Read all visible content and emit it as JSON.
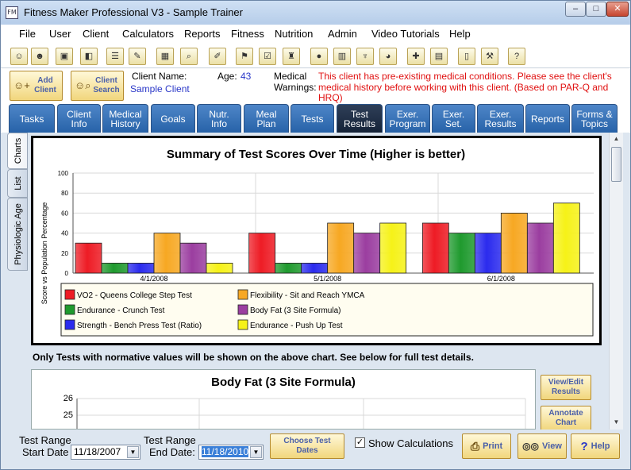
{
  "window": {
    "title": "Fitness Maker Professional V3 - Sample Trainer",
    "app_icon": "FM",
    "controls": [
      "–",
      "□",
      "✕"
    ]
  },
  "menu": [
    "File",
    "User",
    "Client",
    "Calculators",
    "Reports",
    "Fitness",
    "Nutrition",
    "Admin",
    "Video Tutorials",
    "Help"
  ],
  "toolbar_icons": [
    "users-icon",
    "user-icon",
    "save-icon",
    "exit-icon",
    "list-icon",
    "edit-icon",
    "assess-icon",
    "search-icon",
    "note-icon",
    "flag-icon",
    "check-icon",
    "weights-icon",
    "apple-icon",
    "chart-icon",
    "cutlery-icon",
    "food-icon",
    "add-icon",
    "export-icon",
    "clipboard-icon",
    "tools-icon",
    "help-icon"
  ],
  "toolbar_glyphs": [
    "☺",
    "☻",
    "▣",
    "◧",
    "☰",
    "✎",
    "▦",
    "⌕",
    "✐",
    "⚑",
    "☑",
    "♜",
    "●",
    "▥",
    "♆",
    "◕",
    "✚",
    "▤",
    "▯",
    "⚒",
    "?"
  ],
  "client_bar": {
    "add_client": "Add Client",
    "client_search": "Client Search",
    "client_name_label": "Client Name:",
    "client_name": "Sample Client",
    "age_label": "Age:",
    "age": "43",
    "warnings_label_1": "Medical",
    "warnings_label_2": "Warnings:",
    "warning_line_1": "This client has pre-existing medical conditions. Please see the client's",
    "warning_line_2": "medical history before working with this client.  (Based on PAR-Q and",
    "warning_line_3": "HRQ)"
  },
  "tabs": [
    {
      "l1": "Tasks",
      "l2": ""
    },
    {
      "l1": "Client",
      "l2": "Info"
    },
    {
      "l1": "Medical",
      "l2": "History"
    },
    {
      "l1": "Goals",
      "l2": ""
    },
    {
      "l1": "Nutr.",
      "l2": "Info"
    },
    {
      "l1": "Meal",
      "l2": "Plan"
    },
    {
      "l1": "Tests",
      "l2": ""
    },
    {
      "l1": "Test",
      "l2": "Results"
    },
    {
      "l1": "Exer.",
      "l2": "Program"
    },
    {
      "l1": "Exer.",
      "l2": "Set."
    },
    {
      "l1": "Exer.",
      "l2": "Results"
    },
    {
      "l1": "Reports",
      "l2": ""
    },
    {
      "l1": "Forms &",
      "l2": "Topics"
    }
  ],
  "active_tab": 7,
  "side_tabs": [
    "Charts",
    "List",
    "Physiologic Age"
  ],
  "chart_data": [
    {
      "type": "bar",
      "title": "Summary of Test Scores Over Time (Higher is better)",
      "ylabel": "Score vs Population Percentage",
      "xlabel": "",
      "ylim": [
        0,
        100
      ],
      "yticks": [
        "0",
        "20",
        "40",
        "60",
        "80",
        "100"
      ],
      "categories": [
        "4/1/2008",
        "5/1/2008",
        "6/1/2008"
      ],
      "grid": true,
      "legend": "bottom",
      "series": [
        {
          "name": "VO2 - Queens College Step Test",
          "color": "#ee1c25",
          "values": [
            30,
            40,
            50
          ]
        },
        {
          "name": "Endurance - Crunch Test",
          "color": "#1f9a2e",
          "values": [
            10,
            10,
            40
          ]
        },
        {
          "name": "Strength - Bench Press Test  (Ratio)",
          "color": "#2b2bee",
          "values": [
            10,
            10,
            40
          ]
        },
        {
          "name": "Flexibility - Sit and Reach YMCA",
          "color": "#f7a823",
          "values": [
            40,
            50,
            60
          ]
        },
        {
          "name": "Body Fat (3 Site Formula)",
          "color": "#9b3ea0",
          "values": [
            30,
            40,
            50
          ]
        },
        {
          "name": "Endurance - Push Up Test",
          "color": "#f6f218",
          "values": [
            10,
            50,
            70
          ]
        }
      ]
    },
    {
      "type": "line",
      "title": "Body Fat (3 Site Formula)",
      "yticks": [
        "26",
        "25"
      ],
      "ylim": [
        24,
        26
      ]
    }
  ],
  "note": "Only Tests with normative values will be shown on the above chart. See below for full test details.",
  "side_buttons": {
    "view_edit": "View/Edit Results",
    "annotate": "Annotate Chart"
  },
  "bottom": {
    "range1": "Test Range",
    "start_label": "Start Date",
    "start_date": "11/18/2007",
    "range2": "Test Range",
    "end_label": "End Date:",
    "end_date": "11/18/2010",
    "choose": "Choose Test Dates",
    "show_calc": "Show Calculations",
    "print": "Print",
    "view": "View",
    "help": "Help"
  }
}
